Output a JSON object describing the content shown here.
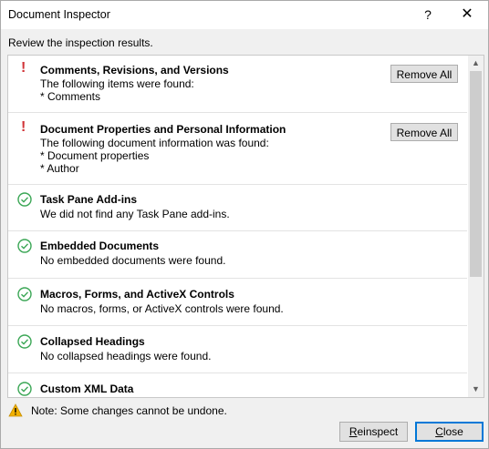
{
  "window": {
    "title": "Document Inspector",
    "help_glyph": "?",
    "close_glyph": "✕"
  },
  "subtitle": "Review the inspection results.",
  "results": [
    {
      "status": "warning",
      "title": "Comments, Revisions, and Versions",
      "lines": [
        "The following items were found:",
        "* Comments"
      ],
      "action_label": "Remove All"
    },
    {
      "status": "warning",
      "title": "Document Properties and Personal Information",
      "lines": [
        "The following document information was found:",
        "* Document properties",
        "* Author"
      ],
      "action_label": "Remove All"
    },
    {
      "status": "ok",
      "title": "Task Pane Add-ins",
      "lines": [
        "We did not find any Task Pane add-ins."
      ]
    },
    {
      "status": "ok",
      "title": "Embedded Documents",
      "lines": [
        "No embedded documents were found."
      ]
    },
    {
      "status": "ok",
      "title": "Macros, Forms, and ActiveX Controls",
      "lines": [
        "No macros, forms, or ActiveX controls were found."
      ]
    },
    {
      "status": "ok",
      "title": "Collapsed Headings",
      "lines": [
        "No collapsed headings were found."
      ]
    },
    {
      "status": "ok",
      "title": "Custom XML Data",
      "lines": []
    }
  ],
  "icons": {
    "warning_mark": "!",
    "ok": "check-circle-icon",
    "note": "warning-triangle-icon"
  },
  "colors": {
    "warning": "#d13438",
    "ok": "#3aa655",
    "note_triangle": "#f2b100",
    "focus_border": "#0078d7"
  },
  "note": "Note: Some changes cannot be undone.",
  "buttons": {
    "reinspect": "Reinspect",
    "close": "Close"
  }
}
